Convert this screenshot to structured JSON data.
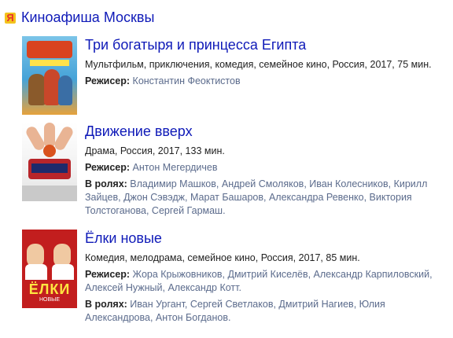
{
  "header": {
    "title": "Киноафиша Москвы",
    "icon": "yandex-icon",
    "icon_glyph": "Я"
  },
  "films": [
    {
      "title": "Три богатыря и принцесса Египта",
      "meta": "Мультфильм, приключения, комедия, семейное кино, Россия, 2017, 75 мин.",
      "director_label": "Режисер:",
      "directors": [
        "Константин Феоктистов"
      ],
      "cast_label": "",
      "cast": []
    },
    {
      "title": "Движение вверх",
      "meta": "Драма, Россия, 2017, 133 мин.",
      "director_label": "Режисер:",
      "directors": [
        "Антон Мегердичев"
      ],
      "cast_label": "В ролях:",
      "cast": [
        "Владимир Машков",
        "Андрей Смоляков",
        "Иван Колесников",
        "Кирилл Зайцев",
        "Джон Сэвэдж",
        "Марат Башаров",
        "Александра Ревенко",
        "Виктория Толстоганова",
        "Сергей Гармаш"
      ]
    },
    {
      "title": "Ёлки новые",
      "meta": "Комедия, мелодрама, семейное кино, Россия, 2017, 85 мин.",
      "director_label": "Режисер:",
      "directors": [
        "Жора Крыжовников",
        "Дмитрий Киселёв",
        "Александр Карпиловский",
        "Алексей Нужный",
        "Александр Котт"
      ],
      "cast_label": "В ролях:",
      "cast": [
        "Иван Ургант",
        "Сергей Светлаков",
        "Дмитрий Нагиев",
        "Юлия Александрова",
        "Антон Богданов"
      ],
      "poster_text": {
        "logo": "ЁЛКИ",
        "sub": "НОВЫЕ"
      }
    }
  ],
  "colors": {
    "link_title": "#0f1ab8",
    "link_person": "#5b6b8c",
    "yandex_icon_bg": "#f3c21b",
    "yandex_icon_fg": "#e8322b"
  }
}
